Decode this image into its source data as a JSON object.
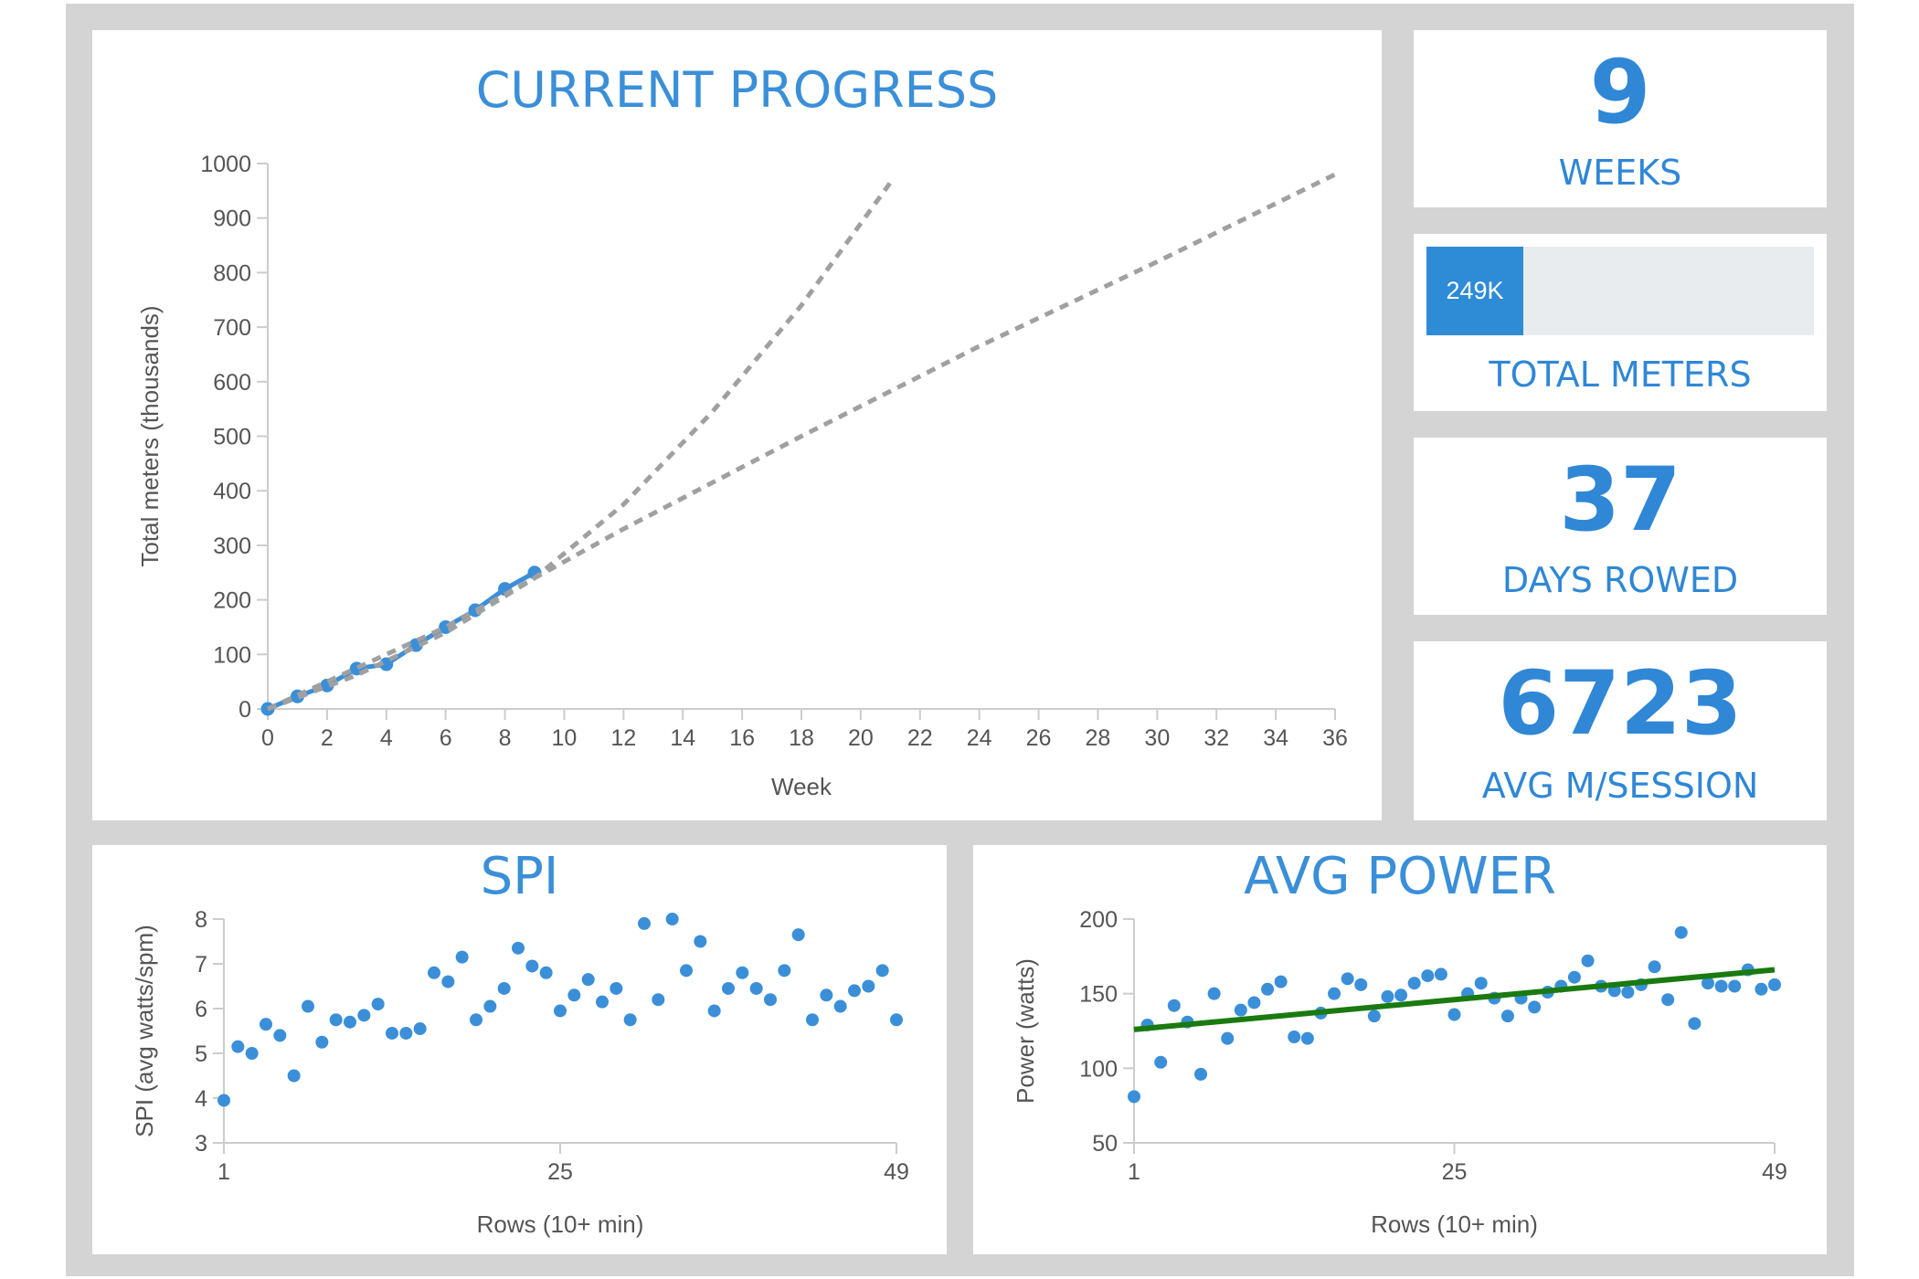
{
  "colors": {
    "accent": "#3a8fd8",
    "point": "#3a8fd8",
    "projection": "#a0a0a0",
    "trend": "#1a7a10",
    "frame": "#d4d4d4",
    "grid_axis": "#cccccc"
  },
  "stats": {
    "weeks": {
      "value": "9",
      "label": "WEEKS"
    },
    "total_meters": {
      "bar_text": "249K",
      "label": "TOTAL METERS",
      "progress_fraction": 0.249
    },
    "days_rowed": {
      "value": "37",
      "label": "DAYS ROWED"
    },
    "avg_session": {
      "value": "6723",
      "label": "AVG M/SESSION"
    }
  },
  "chart_data": [
    {
      "id": "progress",
      "type": "line",
      "title": "CURRENT PROGRESS",
      "xlabel": "Week",
      "ylabel": "Total meters (thousands)",
      "xlim": [
        0,
        36
      ],
      "ylim": [
        0,
        1000
      ],
      "x_ticks": [
        "0",
        "2",
        "4",
        "6",
        "8",
        "10",
        "12",
        "14",
        "16",
        "18",
        "20",
        "22",
        "24",
        "26",
        "28",
        "30",
        "32",
        "34",
        "36"
      ],
      "y_ticks": [
        "0",
        "100",
        "200",
        "300",
        "400",
        "500",
        "600",
        "700",
        "800",
        "900",
        "1000"
      ],
      "grid": false,
      "series": [
        {
          "style": "solid-markers",
          "x": [
            0,
            1,
            2,
            3,
            4,
            5,
            6,
            7,
            8,
            9
          ],
          "y": [
            0,
            23,
            43,
            74,
            82,
            117,
            150,
            181,
            220,
            250
          ]
        },
        {
          "style": "dashed",
          "x": [
            0,
            3,
            6,
            9,
            12,
            15,
            18,
            21
          ],
          "y": [
            0,
            62,
            140,
            240,
            375,
            545,
            740,
            965
          ]
        },
        {
          "style": "dashed",
          "x": [
            0,
            6,
            12,
            18,
            24,
            30,
            36
          ],
          "y": [
            0,
            150,
            330,
            500,
            665,
            820,
            980
          ]
        }
      ]
    },
    {
      "id": "spi",
      "type": "scatter",
      "title": "SPI",
      "xlabel": "Rows (10+ min)",
      "ylabel": "SPI (avg watts/spm)",
      "xlim": [
        1,
        49
      ],
      "ylim": [
        3,
        8
      ],
      "x_ticks": [
        "1",
        "25",
        "49"
      ],
      "y_ticks": [
        "3",
        "4",
        "5",
        "6",
        "7",
        "8"
      ],
      "series": [
        {
          "x": [
            1,
            2,
            3,
            4,
            5,
            6,
            7,
            8,
            9,
            10,
            11,
            12,
            13,
            14,
            15,
            16,
            17,
            18,
            19,
            20,
            21,
            22,
            23,
            24,
            25,
            26,
            27,
            28,
            29,
            30,
            31,
            32,
            33,
            34,
            35,
            36,
            37,
            38,
            39,
            40,
            41,
            42,
            43,
            44,
            45,
            46,
            47,
            48,
            49
          ],
          "y": [
            3.95,
            5.15,
            5.0,
            5.65,
            5.4,
            4.5,
            6.05,
            5.25,
            5.75,
            5.7,
            5.85,
            6.1,
            5.45,
            5.45,
            5.55,
            6.8,
            6.6,
            7.15,
            5.75,
            6.05,
            6.45,
            7.35,
            6.95,
            6.8,
            5.95,
            6.3,
            6.65,
            6.15,
            6.45,
            5.75,
            7.9,
            6.2,
            8.0,
            6.85,
            7.5,
            5.95,
            6.45,
            6.8,
            6.45,
            6.2,
            6.85,
            7.65,
            5.75,
            6.3,
            6.05,
            6.4,
            6.5,
            6.85,
            5.75
          ]
        }
      ]
    },
    {
      "id": "power",
      "type": "scatter",
      "title": "AVG POWER",
      "xlabel": "Rows (10+ min)",
      "ylabel": "Power (watts)",
      "xlim": [
        1,
        49
      ],
      "ylim": [
        50,
        200
      ],
      "x_ticks": [
        "1",
        "25",
        "49"
      ],
      "y_ticks": [
        "50",
        "100",
        "150",
        "200"
      ],
      "series": [
        {
          "x": [
            1,
            2,
            3,
            4,
            5,
            6,
            7,
            8,
            9,
            10,
            11,
            12,
            13,
            14,
            15,
            16,
            17,
            18,
            19,
            20,
            21,
            22,
            23,
            24,
            25,
            26,
            27,
            28,
            29,
            30,
            31,
            32,
            33,
            34,
            35,
            36,
            37,
            38,
            39,
            40,
            41,
            42,
            43,
            44,
            45,
            46,
            47,
            48,
            49
          ],
          "y": [
            81,
            129,
            104,
            142,
            131,
            96,
            150,
            120,
            139,
            144,
            153,
            158,
            121,
            120,
            137,
            150,
            160,
            156,
            135,
            148,
            149,
            157,
            162,
            163,
            136,
            150,
            157,
            147,
            135,
            147,
            141,
            151,
            155,
            161,
            172,
            155,
            152,
            151,
            156,
            168,
            146,
            191,
            130,
            157,
            155,
            155,
            166,
            153,
            156
          ]
        }
      ],
      "trendline": {
        "x": [
          1,
          49
        ],
        "y": [
          126,
          166
        ]
      }
    }
  ]
}
